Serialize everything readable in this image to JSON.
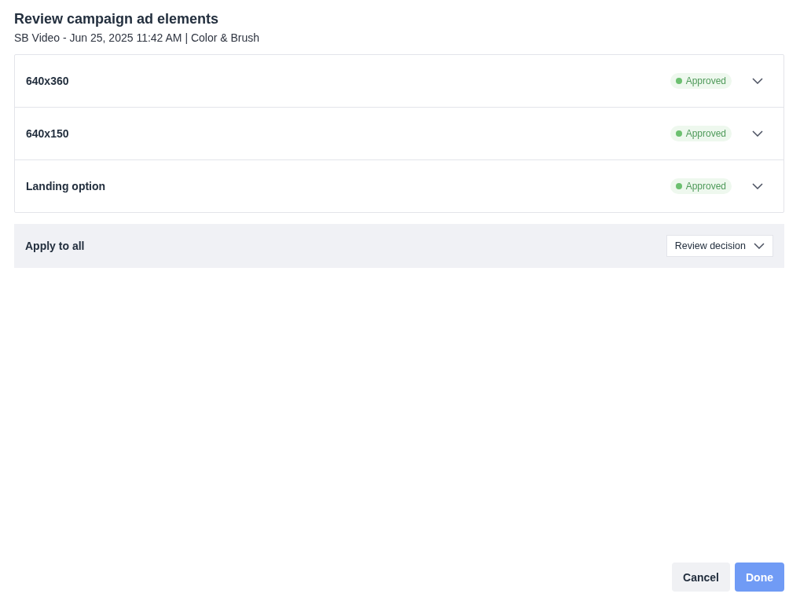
{
  "dialog": {
    "title": "Review campaign ad elements",
    "subtitle": "SB Video - Jun 25, 2025 11:42 AM | Color & Brush"
  },
  "elements": [
    {
      "name": "640x360",
      "status": {
        "kind": "approved",
        "label": "Approved"
      },
      "expanded": false
    },
    {
      "name": "640x150",
      "status": {
        "kind": "approved",
        "label": "Approved"
      },
      "expanded": false
    },
    {
      "name": "Landing option",
      "status": {
        "kind": "approved",
        "label": "Approved"
      },
      "expanded": false
    }
  ],
  "apply_all": {
    "label": "Apply to all",
    "dropdown": {
      "placeholder": "Review decision"
    }
  },
  "buttons": [
    {
      "label": "Cancel",
      "kind": "secondary",
      "disabled": false
    },
    {
      "label": "Done",
      "kind": "primary",
      "disabled": true
    }
  ]
}
